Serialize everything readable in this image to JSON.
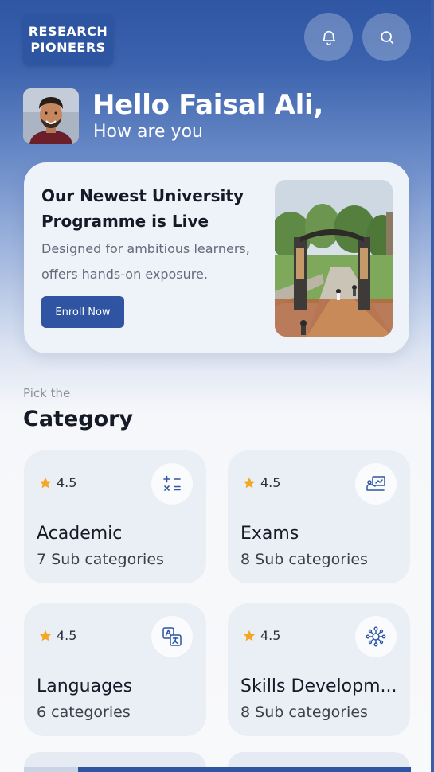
{
  "brand": {
    "line1": "RESEARCH",
    "line2": "PIONEERS"
  },
  "header": {
    "notifications_icon": "bell-icon",
    "search_icon": "search-icon"
  },
  "greeting": {
    "title": "Hello Faisal Ali,",
    "subtitle": "How are you"
  },
  "promo": {
    "title": "Our Newest University Programme is Live",
    "description": "Designed for ambitious learners, offers hands-on exposure.",
    "button_label": "Enroll Now"
  },
  "category": {
    "pick_label": "Pick the",
    "heading": "Category",
    "items": [
      {
        "rating": "4.5",
        "name": "Academic",
        "sub": "7 Sub categories",
        "icon": "math-operators-icon"
      },
      {
        "rating": "4.5",
        "name": "Exams",
        "sub": "8 Sub categories",
        "icon": "presentation-icon"
      },
      {
        "rating": "4.5",
        "name": "Languages",
        "sub": "6 categories",
        "icon": "translate-icon"
      },
      {
        "rating": "4.5",
        "name": "Skills Developm...",
        "sub": "8 Sub categories",
        "icon": "skills-network-icon"
      }
    ]
  },
  "colors": {
    "primary": "#2f55a2",
    "star": "#f5a623",
    "card_bg": "#eaeef5",
    "text_dark": "#141a26"
  }
}
